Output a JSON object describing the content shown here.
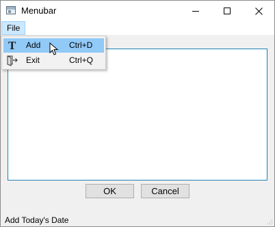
{
  "window": {
    "title": "Menubar",
    "icon": "application-window-icon",
    "controls": [
      "minimize-icon",
      "maximize-icon",
      "close-icon"
    ]
  },
  "menubar": {
    "file_label": "File"
  },
  "file_menu": {
    "items": [
      {
        "icon": "text-t-icon",
        "label": "Add",
        "shortcut": "Ctrl+D",
        "highlighted": true
      },
      {
        "icon": "exit-door-icon",
        "label": "Exit",
        "shortcut": "Ctrl+Q",
        "highlighted": false
      }
    ]
  },
  "text_area": {
    "value": ""
  },
  "buttons": {
    "ok_label": "OK",
    "cancel_label": "Cancel"
  },
  "statusbar": {
    "text": "Add Today's Date"
  },
  "colors": {
    "menu_highlight": "#91c9f7",
    "menubar_selected": "#cce8ff",
    "text_area_border": "#1f7fb5"
  }
}
